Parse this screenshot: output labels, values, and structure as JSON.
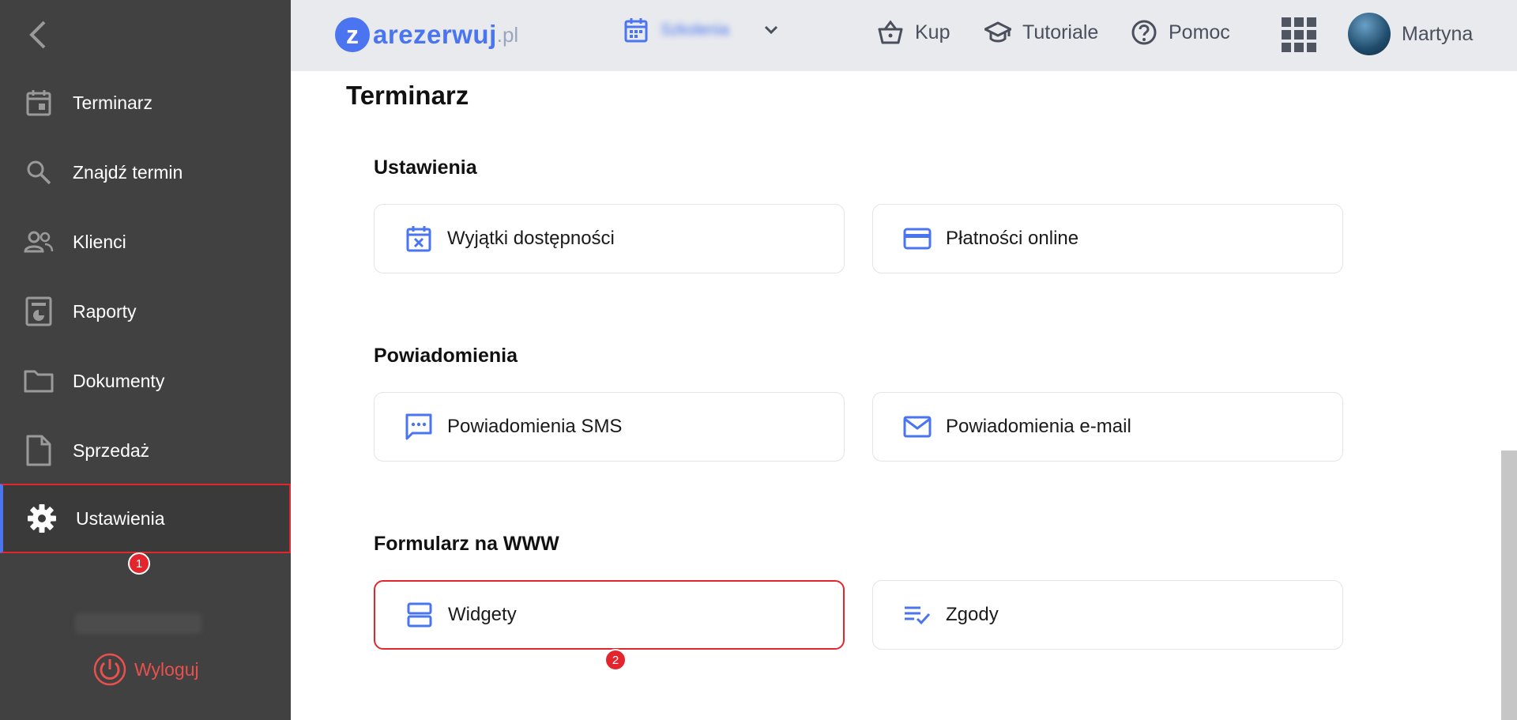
{
  "sidebar": {
    "items": [
      {
        "label": "Terminarz",
        "icon": "calendar-icon"
      },
      {
        "label": "Znajdź termin",
        "icon": "search-icon"
      },
      {
        "label": "Klienci",
        "icon": "people-icon"
      },
      {
        "label": "Raporty",
        "icon": "report-icon"
      },
      {
        "label": "Dokumenty",
        "icon": "folder-icon"
      },
      {
        "label": "Sprzedaż",
        "icon": "document-icon"
      },
      {
        "label": "Ustawienia",
        "icon": "gear-icon",
        "active": true
      }
    ],
    "logout_label": "Wyloguj",
    "step_marker": "1"
  },
  "header": {
    "logo_letter": "z",
    "logo_word": "arezerwuj",
    "logo_tld": ".pl",
    "location": "Szkolenia",
    "links": [
      {
        "label": "Kup",
        "icon": "basket-icon"
      },
      {
        "label": "Tutoriale",
        "icon": "graduation-cap-icon"
      },
      {
        "label": "Pomoc",
        "icon": "help-icon"
      }
    ],
    "user_name": "Martyna"
  },
  "main": {
    "page_title": "Terminarz",
    "sections": [
      {
        "title": "Ustawienia",
        "cards": [
          "Wyjątki dostępności",
          "Płatności online"
        ]
      },
      {
        "title": "Powiadomienia",
        "cards": [
          "Powiadomienia SMS",
          "Powiadomienia e-mail"
        ]
      },
      {
        "title": "Formularz na WWW",
        "cards": [
          "Widgety",
          "Zgody"
        ]
      }
    ],
    "step_marker": "2"
  },
  "colors": {
    "accent": "#4a74f0",
    "sidebar_bg": "#414141",
    "highlight": "#e3262d",
    "logout": "#e8514e"
  }
}
